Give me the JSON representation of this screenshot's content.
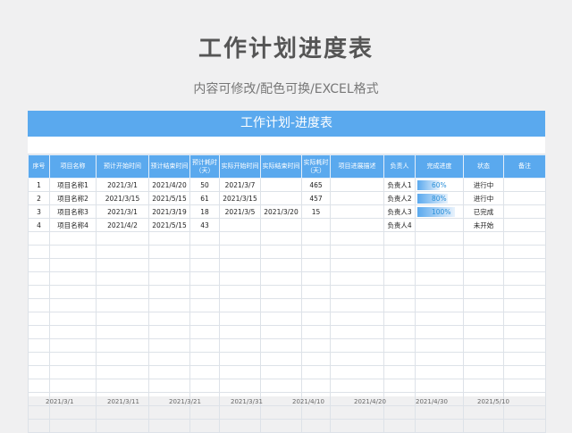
{
  "title": "工作计划进度表",
  "subtitle": "内容可修改/配色可换/EXCEL格式",
  "sheet_title": "工作计划-进度表",
  "headers": [
    "序号",
    "项目名称",
    "预计开始时间",
    "预计结束时间",
    "预计耗时（天）",
    "实际开始时间",
    "实际结束时间",
    "实际耗时（天）",
    "项目进展描述",
    "负责人",
    "完成进度",
    "状态",
    "备注"
  ],
  "rows": [
    [
      "1",
      "项目名称1",
      "2021/3/1",
      "2021/4/20",
      "50",
      "2021/3/7",
      "",
      "465",
      "",
      "负责人1",
      "60%",
      "进行中",
      ""
    ],
    [
      "2",
      "项目名称2",
      "2021/3/15",
      "2021/5/15",
      "61",
      "2021/3/15",
      "",
      "457",
      "",
      "负责人2",
      "80%",
      "进行中",
      ""
    ],
    [
      "3",
      "项目名称3",
      "2021/3/1",
      "2021/3/19",
      "18",
      "2021/3/5",
      "2021/3/20",
      "15",
      "",
      "负责人3",
      "100%",
      "已完成",
      ""
    ],
    [
      "4",
      "项目名称4",
      "2021/4/2",
      "2021/5/15",
      "43",
      "",
      "",
      "",
      "",
      "负责人4",
      "",
      "未开始",
      ""
    ]
  ],
  "progress": [
    0.6,
    0.8,
    1.0,
    null
  ],
  "dates": [
    "2021/3/1",
    "2021/3/11",
    "2021/3/21",
    "2021/3/31",
    "2021/4/10",
    "2021/4/20",
    "2021/4/30",
    "2021/5/10"
  ],
  "colors": {
    "accent": "#5aa9ee",
    "progress_text": "#2a8fd8"
  }
}
